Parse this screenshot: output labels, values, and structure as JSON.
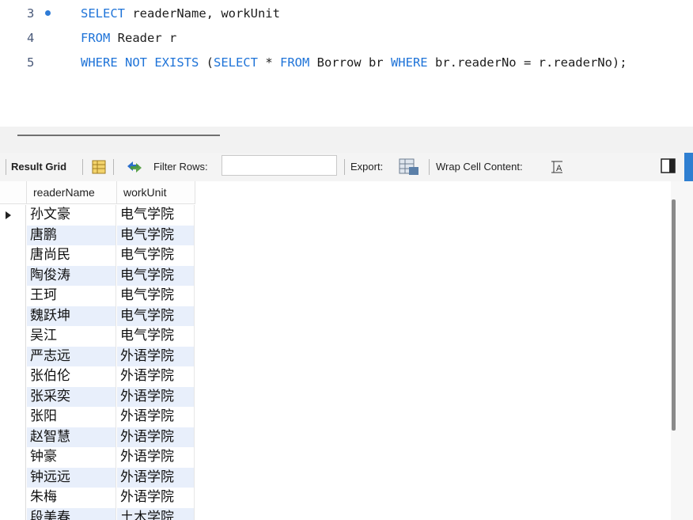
{
  "editor": {
    "lines": [
      {
        "num": "3",
        "has_marker": true,
        "parts": [
          {
            "text": "SELECT",
            "kw": true
          },
          {
            "text": " readerName, workUnit",
            "kw": false
          }
        ]
      },
      {
        "num": "4",
        "has_marker": false,
        "parts": [
          {
            "text": "FROM",
            "kw": true
          },
          {
            "text": " Reader r",
            "kw": false
          }
        ]
      },
      {
        "num": "5",
        "has_marker": false,
        "parts": [
          {
            "text": "WHERE NOT EXISTS",
            "kw": true
          },
          {
            "text": " (",
            "kw": false
          },
          {
            "text": "SELECT",
            "kw": true
          },
          {
            "text": " * ",
            "kw": false
          },
          {
            "text": "FROM",
            "kw": true
          },
          {
            "text": " Borrow br ",
            "kw": false
          },
          {
            "text": "WHERE",
            "kw": true
          },
          {
            "text": " br.readerNo = r.readerNo);",
            "kw": false
          }
        ]
      }
    ]
  },
  "toolbar": {
    "result_grid_label": "Result Grid",
    "filter_rows_label": "Filter Rows:",
    "filter_value": "",
    "export_label": "Export:",
    "wrap_label": "Wrap Cell Content:"
  },
  "grid": {
    "columns": [
      "readerName",
      "workUnit"
    ],
    "rows": [
      [
        "孙文豪",
        "电气学院"
      ],
      [
        "唐鹏",
        "电气学院"
      ],
      [
        "唐尚民",
        "电气学院"
      ],
      [
        "陶俊涛",
        "电气学院"
      ],
      [
        "王珂",
        "电气学院"
      ],
      [
        "魏跃坤",
        "电气学院"
      ],
      [
        "吴江",
        "电气学院"
      ],
      [
        "严志远",
        "外语学院"
      ],
      [
        "张伯伦",
        "外语学院"
      ],
      [
        "张采奕",
        "外语学院"
      ],
      [
        "张阳",
        "外语学院"
      ],
      [
        "赵智慧",
        "外语学院"
      ],
      [
        "钟豪",
        "外语学院"
      ],
      [
        "钟远远",
        "外语学院"
      ],
      [
        "朱梅",
        "外语学院"
      ],
      [
        "段美春",
        "土木学院"
      ]
    ],
    "selected_row": 0
  },
  "colors": {
    "keyword": "#1e73d8",
    "row_alt": "#e8effb",
    "accent_strip": "#2f7fd1"
  }
}
